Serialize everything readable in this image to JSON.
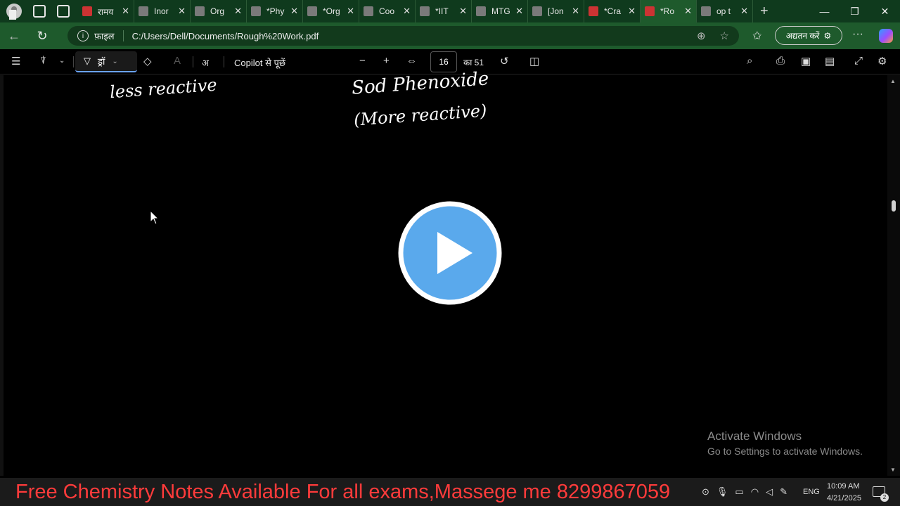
{
  "browser": {
    "tabs": [
      {
        "title": "रामय",
        "type": "pdf"
      },
      {
        "title": "Inor",
        "type": "page"
      },
      {
        "title": "Org",
        "type": "page"
      },
      {
        "title": "*Phy",
        "type": "page"
      },
      {
        "title": "*Org",
        "type": "page"
      },
      {
        "title": "Coo",
        "type": "page"
      },
      {
        "title": "*IIT",
        "type": "page"
      },
      {
        "title": "MTG",
        "type": "page"
      },
      {
        "title": "[Jon",
        "type": "page"
      },
      {
        "title": "*Cra",
        "type": "pdf"
      },
      {
        "title": "*Ro",
        "type": "pdf",
        "active": true
      },
      {
        "title": "op t",
        "type": "page"
      }
    ],
    "address": {
      "label": "फ़ाइल",
      "url": "C:/Users/Dell/Documents/Rough%20Work.pdf"
    },
    "update_button": "अद्यतन करें"
  },
  "pdf_toolbar": {
    "draw_label": "ड्रॉ",
    "copilot_label": "Copilot से पूछें",
    "current_page": "16",
    "total_pages": "का 51"
  },
  "document": {
    "handwriting_left": "less reactive",
    "handwriting_right_1": "Sod Phenoxide",
    "handwriting_right_2": "(More reactive)"
  },
  "watermark": {
    "line1": "Activate Windows",
    "line2": "Go to Settings to activate Windows."
  },
  "banner": "Free Chemistry Notes Available For all exams,Massege me 8299867059",
  "taskbar": {
    "lang": "ENG",
    "time": "10:09 AM",
    "date": "4/21/2025",
    "notifications": "2"
  }
}
